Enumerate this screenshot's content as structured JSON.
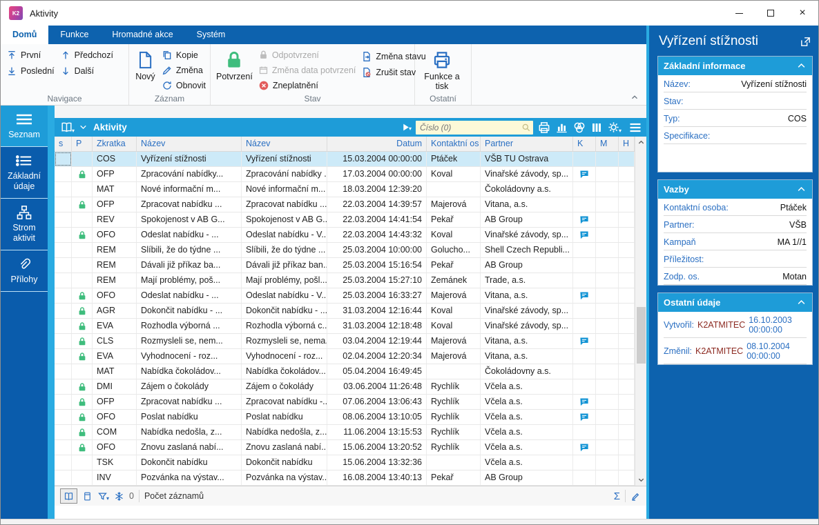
{
  "titlebar": {
    "logo_text": "K2",
    "title": "Aktivity"
  },
  "ribbon": {
    "tabs": [
      {
        "label": "Domů",
        "active": true
      },
      {
        "label": "Funkce"
      },
      {
        "label": "Hromadné akce"
      },
      {
        "label": "Systém"
      }
    ],
    "navigace": {
      "label": "Navigace",
      "first": "První",
      "previous": "Předchozí",
      "last": "Poslední",
      "next": "Další"
    },
    "zaznam": {
      "label": "Záznam",
      "new": "Nový",
      "copy": "Kopie",
      "change": "Změna",
      "refresh": "Obnovit"
    },
    "stav": {
      "label": "Stav",
      "confirm": "Potvrzení",
      "unconfirm": "Odpotvrzení",
      "change_confirm_date": "Změna data potvrzení",
      "invalidate": "Zneplatnění",
      "change_state": "Změna stavu",
      "cancel_state": "Zrušit stav"
    },
    "ostatni": {
      "label": "Ostatní",
      "functions_print": "Funkce a tisk"
    }
  },
  "sidebar": {
    "items": [
      {
        "label": "Seznam",
        "icon": "menu",
        "active": true
      },
      {
        "label": "Základní údaje",
        "icon": "list",
        "active": false
      },
      {
        "label": "Strom aktivit",
        "icon": "tree",
        "active": false
      },
      {
        "label": "Přílohy",
        "icon": "paperclip",
        "active": false
      }
    ]
  },
  "grid": {
    "toolbar": {
      "title": "Aktivity",
      "search_placeholder": "Číslo (0)"
    },
    "columns": [
      "s",
      "P",
      "Zkratka",
      "Název",
      "Název",
      "Datum",
      "Kontaktní os",
      "Partner",
      "K",
      "M",
      "H"
    ],
    "rows": [
      {
        "locked": false,
        "code": "COS",
        "name": "Vyřízení stížnosti",
        "name2": "Vyřízení stížnosti",
        "date": "15.03.2004 00:00:00",
        "contact": "Ptáček",
        "partner": "VŠB TU Ostrava",
        "comment": false,
        "selected": true
      },
      {
        "locked": true,
        "code": "OFP",
        "name": "Zpracování nabídky...",
        "name2": "Zpracování nabídky ...",
        "date": "17.03.2004 00:00:00",
        "contact": "Koval",
        "partner": "Vinařské závody, sp...",
        "comment": true
      },
      {
        "locked": false,
        "code": "MAT",
        "name": "Nové informační m...",
        "name2": "Nové informační m...",
        "date": "18.03.2004 12:39:20",
        "contact": "",
        "partner": "Čokoládovny a.s.",
        "comment": false
      },
      {
        "locked": true,
        "code": "OFP",
        "name": "Zpracovat nabídku ...",
        "name2": "Zpracovat nabídku ...",
        "date": "22.03.2004 14:39:57",
        "contact": "Majerová",
        "partner": "Vitana, a.s.",
        "comment": false
      },
      {
        "locked": false,
        "code": "REV",
        "name": "Spokojenost v AB G...",
        "name2": "Spokojenost v AB G...",
        "date": "22.03.2004 14:41:54",
        "contact": "Pekař",
        "partner": "AB Group",
        "comment": true
      },
      {
        "locked": true,
        "code": "OFO",
        "name": "Odeslat nabídku - ...",
        "name2": "Odeslat nabídku - V...",
        "date": "22.03.2004 14:43:32",
        "contact": "Koval",
        "partner": "Vinařské závody, sp...",
        "comment": true
      },
      {
        "locked": false,
        "code": "REM",
        "name": "Slíbili, že do týdne ...",
        "name2": "Slíbili, že do týdne ...",
        "date": "25.03.2004 10:00:00",
        "contact": "Golucho...",
        "partner": "Shell Czech Republi...",
        "comment": false
      },
      {
        "locked": false,
        "code": "REM",
        "name": "Dávali již příkaz ba...",
        "name2": "Dávali již příkaz ban...",
        "date": "25.03.2004 15:16:54",
        "contact": "Pekař",
        "partner": "AB Group",
        "comment": false
      },
      {
        "locked": false,
        "code": "REM",
        "name": "Mají problémy, poš...",
        "name2": "Mají problémy, pošl...",
        "date": "25.03.2004 15:27:10",
        "contact": "Zemánek",
        "partner": "Trade, a.s.",
        "comment": false
      },
      {
        "locked": true,
        "code": "OFO",
        "name": "Odeslat nabídku - ...",
        "name2": "Odeslat nabídku - V...",
        "date": "25.03.2004 16:33:27",
        "contact": "Majerová",
        "partner": "Vitana, a.s.",
        "comment": true
      },
      {
        "locked": true,
        "code": "AGR",
        "name": "Dokončit nabídku - ...",
        "name2": "Dokončit nabídku - ...",
        "date": "31.03.2004 12:16:44",
        "contact": "Koval",
        "partner": "Vinařské závody, sp...",
        "comment": false
      },
      {
        "locked": true,
        "code": "EVA",
        "name": "Rozhodla výborná ...",
        "name2": "Rozhodla výborná c...",
        "date": "31.03.2004 12:18:48",
        "contact": "Koval",
        "partner": "Vinařské závody, sp...",
        "comment": false
      },
      {
        "locked": true,
        "code": "CLS",
        "name": "Rozmysleli se, nem...",
        "name2": "Rozmysleli se, nema...",
        "date": "03.04.2004 12:19:44",
        "contact": "Majerová",
        "partner": "Vitana, a.s.",
        "comment": true
      },
      {
        "locked": true,
        "code": "EVA",
        "name": "Vyhodnocení - roz...",
        "name2": "Vyhodnocení - roz...",
        "date": "02.04.2004 12:20:34",
        "contact": "Majerová",
        "partner": "Vitana, a.s.",
        "comment": false
      },
      {
        "locked": false,
        "code": "MAT",
        "name": "Nabídka čokoládov...",
        "name2": "Nabídka čokoládov...",
        "date": "05.04.2004 16:49:45",
        "contact": "",
        "partner": "Čokoládovny a.s.",
        "comment": false
      },
      {
        "locked": true,
        "code": "DMI",
        "name": "Zájem o čokolády",
        "name2": "Zájem o čokolády",
        "date": "03.06.2004 11:26:48",
        "contact": "Rychlík",
        "partner": "Včela a.s.",
        "comment": false
      },
      {
        "locked": true,
        "code": "OFP",
        "name": "Zpracovat nabídku ...",
        "name2": "Zpracovat nabídku -...",
        "date": "07.06.2004 13:06:43",
        "contact": "Rychlík",
        "partner": "Včela a.s.",
        "comment": true
      },
      {
        "locked": true,
        "code": "OFO",
        "name": "Poslat nabídku",
        "name2": "Poslat nabídku",
        "date": "08.06.2004 13:10:05",
        "contact": "Rychlík",
        "partner": "Včela a.s.",
        "comment": true
      },
      {
        "locked": true,
        "code": "COM",
        "name": "Nabídka nedošla, z...",
        "name2": "Nabídka nedošla, z...",
        "date": "11.06.2004 13:15:53",
        "contact": "Rychlík",
        "partner": "Včela a.s.",
        "comment": false
      },
      {
        "locked": true,
        "code": "OFO",
        "name": "Znovu zaslaná nabí...",
        "name2": "Znovu zaslaná nabí...",
        "date": "15.06.2004 13:20:52",
        "contact": "Rychlík",
        "partner": "Včela a.s.",
        "comment": true
      },
      {
        "locked": false,
        "code": "TSK",
        "name": "Dokončit nabídku",
        "name2": "Dokončit nabídku",
        "date": "15.06.2004 13:32:36",
        "contact": "",
        "partner": "Včela a.s.",
        "comment": false
      },
      {
        "locked": false,
        "code": "INV",
        "name": "Pozvánka na výstav...",
        "name2": "Pozvánka na výstav...",
        "date": "16.08.2004 13:40:13",
        "contact": "Pekař",
        "partner": "AB Group",
        "comment": false
      }
    ],
    "statusbar": {
      "badge_count": "0",
      "records_label": "Počet záznamů"
    }
  },
  "panel": {
    "title": "Vyřízení stížnosti",
    "sections": [
      {
        "title": "Základní informace",
        "spacer": true,
        "fields": [
          {
            "label": "Název:",
            "value": "Vyřízení stížnosti"
          },
          {
            "label": "Stav:",
            "value": ""
          },
          {
            "label": "Typ:",
            "value": "COS"
          },
          {
            "label": "Specifikace:",
            "value": ""
          }
        ]
      },
      {
        "title": "Vazby",
        "fields": [
          {
            "label": "Kontaktní osoba:",
            "value": "Ptáček"
          },
          {
            "label": "Partner:",
            "value": "VŠB"
          },
          {
            "label": "Kampaň",
            "value": "MA 1//1"
          },
          {
            "label": "Příležitost:",
            "value": ""
          },
          {
            "label": "Zodp. os.",
            "value": "Motan"
          }
        ]
      },
      {
        "title": "Ostatní údaje",
        "fields": [
          {
            "label": "Vytvořil:",
            "user": "K2ATMITEC",
            "value": "16.10.2003 00:00:00"
          },
          {
            "label": "Změnil:",
            "user": "K2ATMITEC",
            "value": "08.10.2004 00:00:00"
          }
        ]
      }
    ]
  },
  "colors": {
    "accent_blue": "#1e9cd8",
    "dark_blue": "#0d62ae",
    "sidebar_blue": "#0a5cac",
    "cyan": "#2aabe2",
    "link_blue": "#2a6fc2",
    "green_lock": "#3fbd7d",
    "red_invalid": "#e25c5c",
    "maroon_user": "#8c2a21",
    "selected_row": "#cdeaf8",
    "search_bg": "#fdf9d8"
  }
}
